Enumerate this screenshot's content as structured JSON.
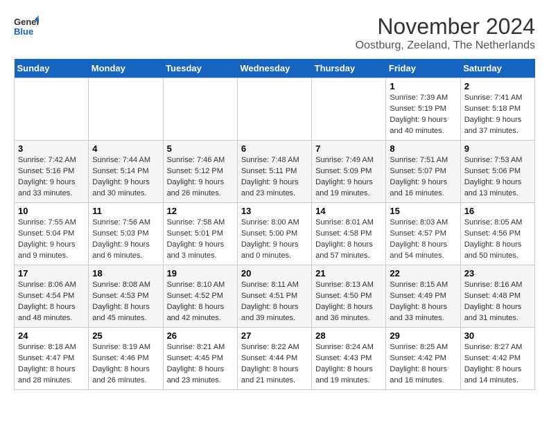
{
  "header": {
    "logo_general": "General",
    "logo_blue": "Blue",
    "title": "November 2024",
    "subtitle": "Oostburg, Zeeland, The Netherlands"
  },
  "days_of_week": [
    "Sunday",
    "Monday",
    "Tuesday",
    "Wednesday",
    "Thursday",
    "Friday",
    "Saturday"
  ],
  "weeks": [
    [
      {
        "day": "",
        "info": ""
      },
      {
        "day": "",
        "info": ""
      },
      {
        "day": "",
        "info": ""
      },
      {
        "day": "",
        "info": ""
      },
      {
        "day": "",
        "info": ""
      },
      {
        "day": "1",
        "info": "Sunrise: 7:39 AM\nSunset: 5:19 PM\nDaylight: 9 hours and 40 minutes."
      },
      {
        "day": "2",
        "info": "Sunrise: 7:41 AM\nSunset: 5:18 PM\nDaylight: 9 hours and 37 minutes."
      }
    ],
    [
      {
        "day": "3",
        "info": "Sunrise: 7:42 AM\nSunset: 5:16 PM\nDaylight: 9 hours and 33 minutes."
      },
      {
        "day": "4",
        "info": "Sunrise: 7:44 AM\nSunset: 5:14 PM\nDaylight: 9 hours and 30 minutes."
      },
      {
        "day": "5",
        "info": "Sunrise: 7:46 AM\nSunset: 5:12 PM\nDaylight: 9 hours and 26 minutes."
      },
      {
        "day": "6",
        "info": "Sunrise: 7:48 AM\nSunset: 5:11 PM\nDaylight: 9 hours and 23 minutes."
      },
      {
        "day": "7",
        "info": "Sunrise: 7:49 AM\nSunset: 5:09 PM\nDaylight: 9 hours and 19 minutes."
      },
      {
        "day": "8",
        "info": "Sunrise: 7:51 AM\nSunset: 5:07 PM\nDaylight: 9 hours and 16 minutes."
      },
      {
        "day": "9",
        "info": "Sunrise: 7:53 AM\nSunset: 5:06 PM\nDaylight: 9 hours and 13 minutes."
      }
    ],
    [
      {
        "day": "10",
        "info": "Sunrise: 7:55 AM\nSunset: 5:04 PM\nDaylight: 9 hours and 9 minutes."
      },
      {
        "day": "11",
        "info": "Sunrise: 7:56 AM\nSunset: 5:03 PM\nDaylight: 9 hours and 6 minutes."
      },
      {
        "day": "12",
        "info": "Sunrise: 7:58 AM\nSunset: 5:01 PM\nDaylight: 9 hours and 3 minutes."
      },
      {
        "day": "13",
        "info": "Sunrise: 8:00 AM\nSunset: 5:00 PM\nDaylight: 9 hours and 0 minutes."
      },
      {
        "day": "14",
        "info": "Sunrise: 8:01 AM\nSunset: 4:58 PM\nDaylight: 8 hours and 57 minutes."
      },
      {
        "day": "15",
        "info": "Sunrise: 8:03 AM\nSunset: 4:57 PM\nDaylight: 8 hours and 54 minutes."
      },
      {
        "day": "16",
        "info": "Sunrise: 8:05 AM\nSunset: 4:56 PM\nDaylight: 8 hours and 50 minutes."
      }
    ],
    [
      {
        "day": "17",
        "info": "Sunrise: 8:06 AM\nSunset: 4:54 PM\nDaylight: 8 hours and 48 minutes."
      },
      {
        "day": "18",
        "info": "Sunrise: 8:08 AM\nSunset: 4:53 PM\nDaylight: 8 hours and 45 minutes."
      },
      {
        "day": "19",
        "info": "Sunrise: 8:10 AM\nSunset: 4:52 PM\nDaylight: 8 hours and 42 minutes."
      },
      {
        "day": "20",
        "info": "Sunrise: 8:11 AM\nSunset: 4:51 PM\nDaylight: 8 hours and 39 minutes."
      },
      {
        "day": "21",
        "info": "Sunrise: 8:13 AM\nSunset: 4:50 PM\nDaylight: 8 hours and 36 minutes."
      },
      {
        "day": "22",
        "info": "Sunrise: 8:15 AM\nSunset: 4:49 PM\nDaylight: 8 hours and 33 minutes."
      },
      {
        "day": "23",
        "info": "Sunrise: 8:16 AM\nSunset: 4:48 PM\nDaylight: 8 hours and 31 minutes."
      }
    ],
    [
      {
        "day": "24",
        "info": "Sunrise: 8:18 AM\nSunset: 4:47 PM\nDaylight: 8 hours and 28 minutes."
      },
      {
        "day": "25",
        "info": "Sunrise: 8:19 AM\nSunset: 4:46 PM\nDaylight: 8 hours and 26 minutes."
      },
      {
        "day": "26",
        "info": "Sunrise: 8:21 AM\nSunset: 4:45 PM\nDaylight: 8 hours and 23 minutes."
      },
      {
        "day": "27",
        "info": "Sunrise: 8:22 AM\nSunset: 4:44 PM\nDaylight: 8 hours and 21 minutes."
      },
      {
        "day": "28",
        "info": "Sunrise: 8:24 AM\nSunset: 4:43 PM\nDaylight: 8 hours and 19 minutes."
      },
      {
        "day": "29",
        "info": "Sunrise: 8:25 AM\nSunset: 4:42 PM\nDaylight: 8 hours and 16 minutes."
      },
      {
        "day": "30",
        "info": "Sunrise: 8:27 AM\nSunset: 4:42 PM\nDaylight: 8 hours and 14 minutes."
      }
    ]
  ]
}
